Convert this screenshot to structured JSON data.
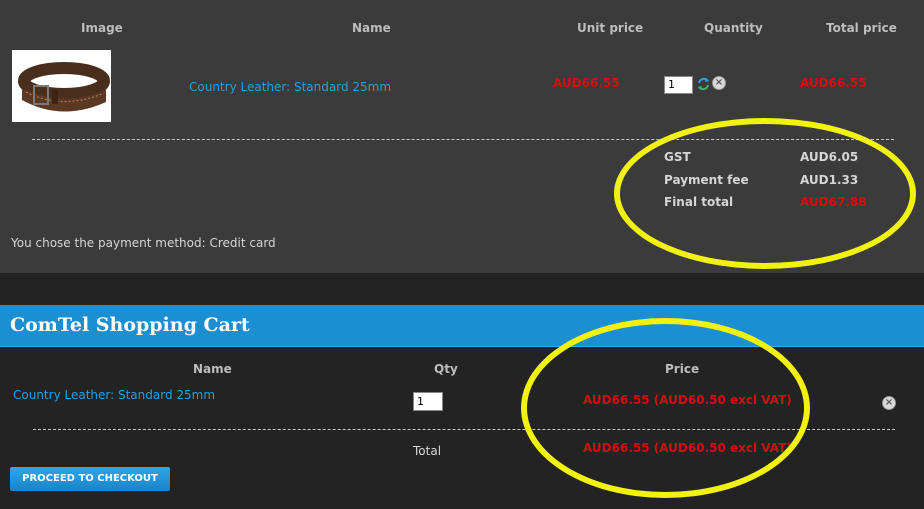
{
  "table": {
    "headers": {
      "image": "Image",
      "name": "Name",
      "unit_price": "Unit price",
      "quantity": "Quantity",
      "total_price": "Total price"
    },
    "item": {
      "image_icon": "belt-product-image",
      "name": "Country Leather: Standard 25mm",
      "unit_price": "AUD66.55",
      "quantity": "1",
      "total_price": "AUD66.55"
    }
  },
  "summary": {
    "gst_label": "GST",
    "gst_value": "AUD6.05",
    "fee_label": "Payment fee",
    "fee_value": "AUD1.33",
    "final_label": "Final total",
    "final_value": "AUD67.88"
  },
  "payment_method_text": "You chose the payment method: Credit card",
  "cart": {
    "title": "ComTel Shopping Cart",
    "headers": {
      "name": "Name",
      "qty": "Qty",
      "price": "Price"
    },
    "item": {
      "name": "Country Leather: Standard 25mm",
      "qty": "1",
      "price": "AUD66.55 (AUD60.50 excl VAT)"
    },
    "total_label": "Total",
    "total_value": "AUD66.55 (AUD60.50 excl VAT)",
    "checkout_label": "PROCEED TO CHECKOUT"
  },
  "colors": {
    "price_red": "#d40d0d",
    "link_blue": "#22a0e0",
    "highlight_yellow": "#f2f20f",
    "cart_bar_blue": "#1c8fd2"
  }
}
